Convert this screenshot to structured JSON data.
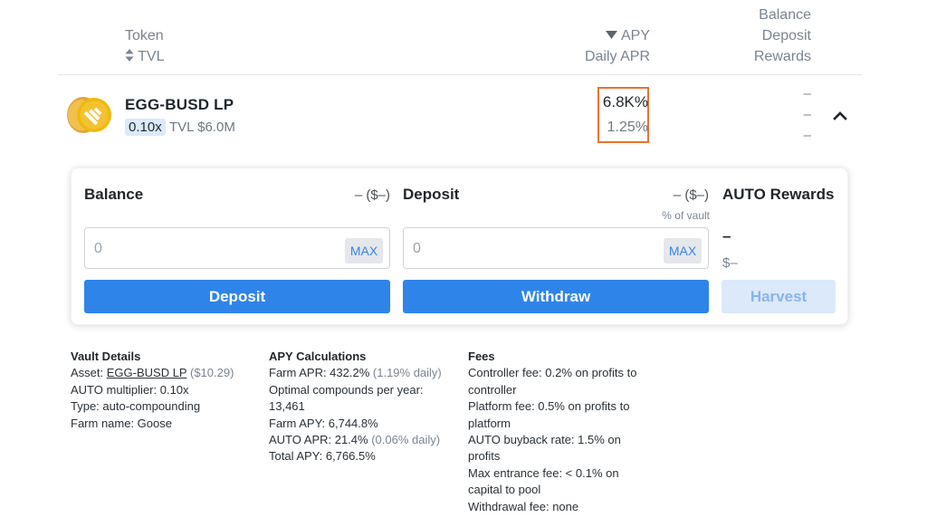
{
  "header": {
    "token_label": "Token",
    "tvl_label": "TVL",
    "sort_icon": "updown-sort-icon",
    "apy_label": "APY",
    "apy_sort_icon": "caret-down-icon",
    "daily_apr_label": "Daily APR",
    "balance_label": "Balance",
    "deposit_label": "Deposit",
    "rewards_label": "Rewards"
  },
  "row": {
    "token_name": "EGG-BUSD LP",
    "multiplier": "0.10x",
    "tvl": "TVL $6.0M",
    "apy": "6.8K%",
    "daily_apr": "1.25%",
    "balance": "–",
    "deposit": "–",
    "rewards": "–",
    "highlight_color": "#e8742f"
  },
  "panel": {
    "balance_title": "Balance",
    "balance_value": "– ($–)",
    "balance_input_value": "0",
    "balance_max": "MAX",
    "deposit_button": "Deposit",
    "deposit_title": "Deposit",
    "deposit_value": "– ($–)",
    "pct_of_vault": "% of vault",
    "deposit_input_value": "0",
    "deposit_max": "MAX",
    "withdraw_button": "Withdraw",
    "rewards_title": "AUTO Rewards",
    "rewards_amount": "–",
    "rewards_usd": "$–",
    "harvest_button": "Harvest",
    "primary_color": "#2f84ea"
  },
  "vault_details": {
    "title": "Vault Details",
    "asset_prefix": "Asset: ",
    "asset_link": "EGG-BUSD LP",
    "asset_price": " ($10.29)",
    "multiplier": "AUTO multiplier: 0.10x",
    "type": "Type: auto-compounding",
    "farm": "Farm name: Goose"
  },
  "apy_calc": {
    "title": "APY Calculations",
    "farm_apr": "Farm APR: 432.2%",
    "farm_apr_daily": " (1.19% daily)",
    "optimal_line1": "Optimal compounds per year:",
    "optimal_line2": "13,461",
    "farm_apy": "Farm APY: 6,744.8%",
    "auto_apr": "AUTO APR: 21.4%",
    "auto_apr_daily": " (0.06% daily)",
    "total_apy": "Total APY: 6,766.5%"
  },
  "fees": {
    "title": "Fees",
    "controller_1": "Controller fee: 0.2% on profits to",
    "controller_2": "controller",
    "platform_1": "Platform fee: 0.5% on profits to",
    "platform_2": "platform",
    "buyback_1": "AUTO buyback rate: 1.5% on",
    "buyback_2": "profits",
    "entrance_1": "Max entrance fee: < 0.1% on",
    "entrance_2": "capital to pool",
    "withdrawal": "Withdrawal fee: none"
  }
}
